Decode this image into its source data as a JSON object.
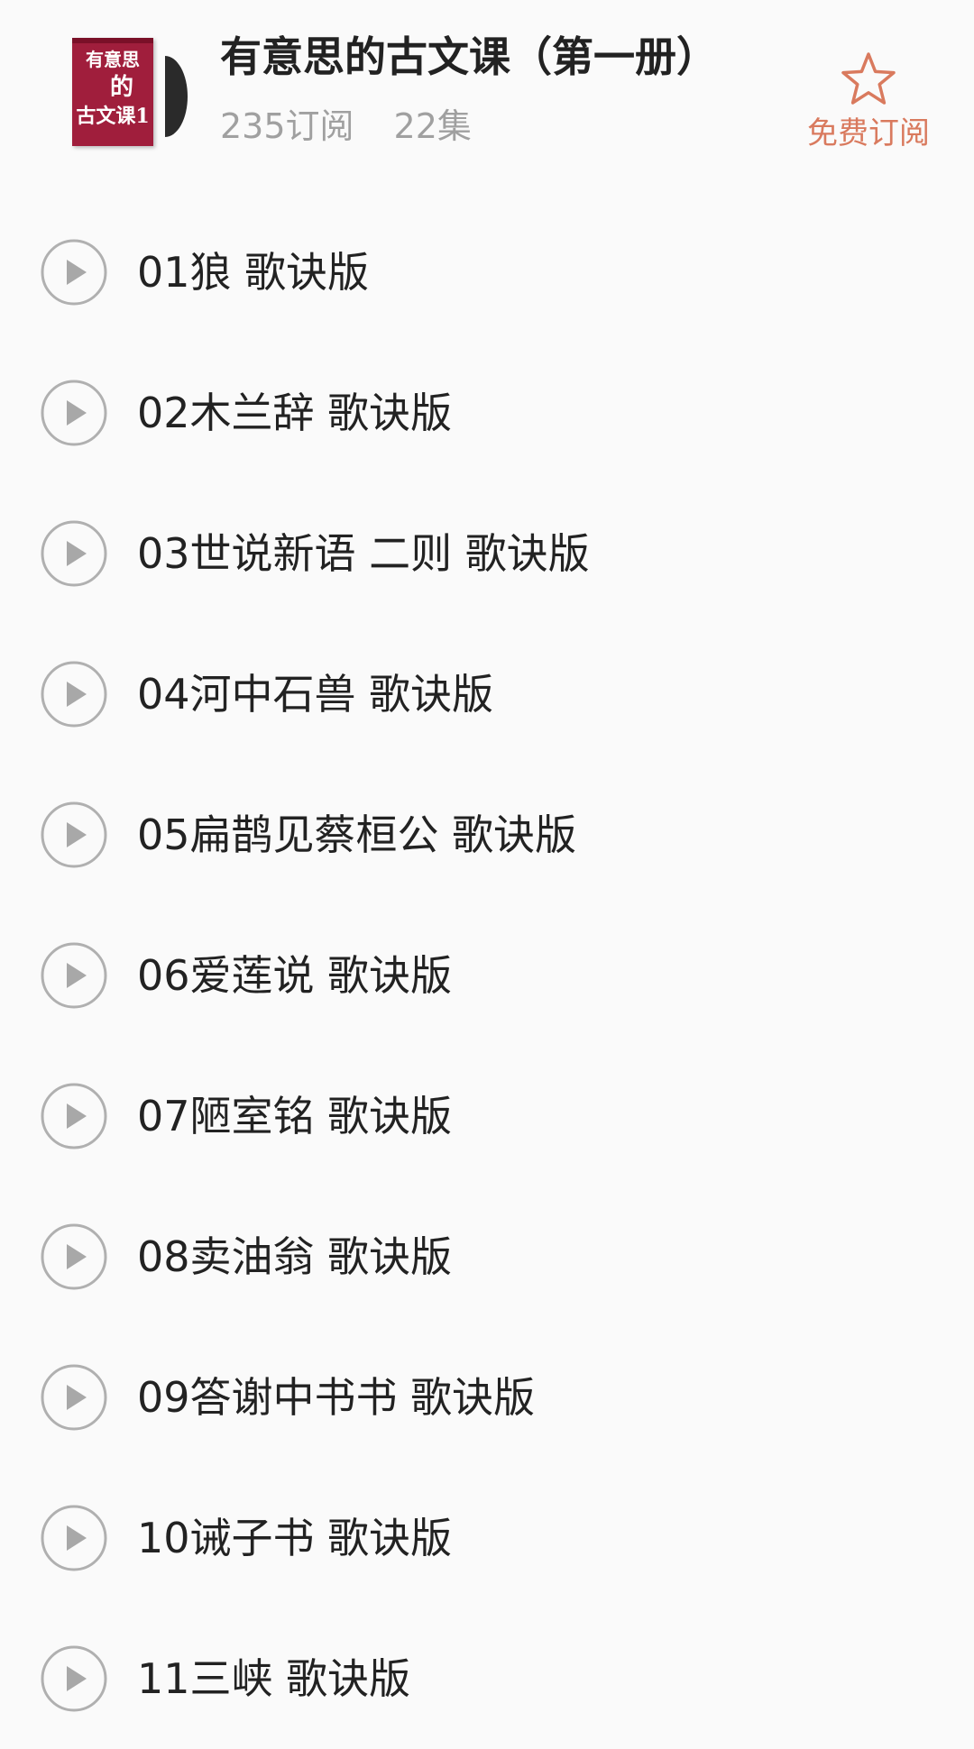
{
  "album": {
    "cover": {
      "line1": "有意思",
      "line2": "的",
      "line3": "古文课1"
    },
    "title": "有意思的古文课（第一册）",
    "subscribers": "235订阅",
    "episodes": "22集"
  },
  "subscribe": {
    "label": "免费订阅",
    "icon": "star-outline-icon",
    "color": "#d97a5e"
  },
  "tracks": [
    {
      "label": "01狼 歌诀版"
    },
    {
      "label": "02木兰辞 歌诀版"
    },
    {
      "label": "03世说新语 二则 歌诀版"
    },
    {
      "label": "04河中石兽 歌诀版"
    },
    {
      "label": "05扁鹊见蔡桓公 歌诀版"
    },
    {
      "label": "06爱莲说 歌诀版"
    },
    {
      "label": "07陋室铭 歌诀版"
    },
    {
      "label": "08卖油翁 歌诀版"
    },
    {
      "label": "09答谢中书书 歌诀版"
    },
    {
      "label": "10诫子书 歌诀版"
    },
    {
      "label": "11三峡 歌诀版"
    }
  ]
}
